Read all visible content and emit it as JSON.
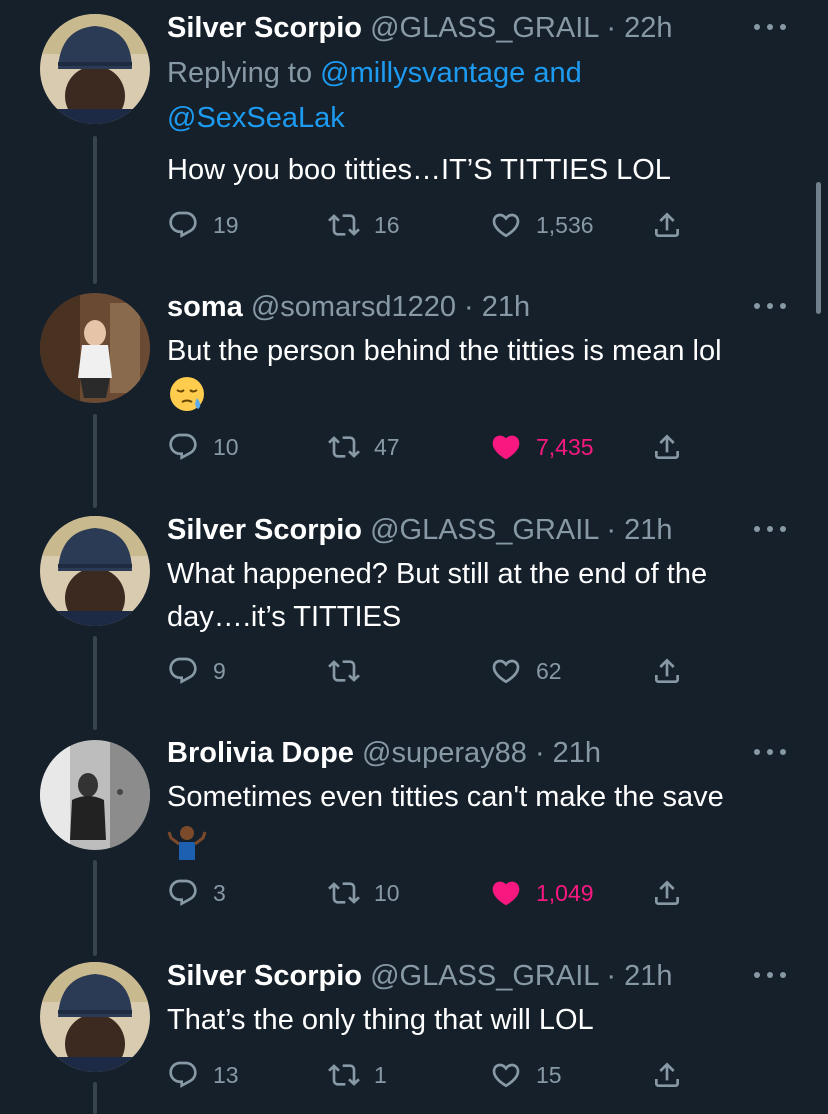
{
  "tweets": [
    {
      "name": "Silver Scorpio",
      "handle": "@GLASS_GRAIL",
      "dot": "·",
      "time": "22h",
      "reply_prefix": "Replying to",
      "reply_user1": "@millysvantage",
      "reply_and": "and",
      "reply_user2": "@SexSeaLak",
      "text": "How you boo titties…IT’S TITTIES  LOL",
      "replies": "19",
      "retweets": "16",
      "likes": "1,536",
      "liked": false
    },
    {
      "name": "soma",
      "handle": "@somarsd1220",
      "dot": "·",
      "time": "21h",
      "text": "But the person behind the titties is mean lol",
      "emoji": "sleepy-face-emoji",
      "replies": "10",
      "retweets": "47",
      "likes": "7,435",
      "liked": true
    },
    {
      "name": "Silver Scorpio",
      "handle": "@GLASS_GRAIL",
      "dot": "·",
      "time": "21h",
      "text_line1": "What happened? But still at the end of the",
      "text_line2": "day….it’s TITTIES",
      "replies": "9",
      "retweets": "",
      "likes": "62",
      "liked": false
    },
    {
      "name": "Brolivia Dope",
      "handle": "@superay88",
      "dot": "·",
      "time": "21h",
      "text": "Sometimes even titties can't make the save",
      "emoji": "person-shrugging-emoji",
      "replies": "3",
      "retweets": "10",
      "likes": "1,049",
      "liked": true
    },
    {
      "name": "Silver Scorpio",
      "handle": "@GLASS_GRAIL",
      "dot": "·",
      "time": "21h",
      "text": "That’s the only thing that will LOL",
      "replies": "13",
      "retweets": "1",
      "likes": "15",
      "liked": false
    }
  ],
  "colors": {
    "background": "#15202b",
    "secondary_text": "#8899a6",
    "link": "#1d9bf0",
    "like_active": "#f91880",
    "thread_line": "#38444d"
  }
}
